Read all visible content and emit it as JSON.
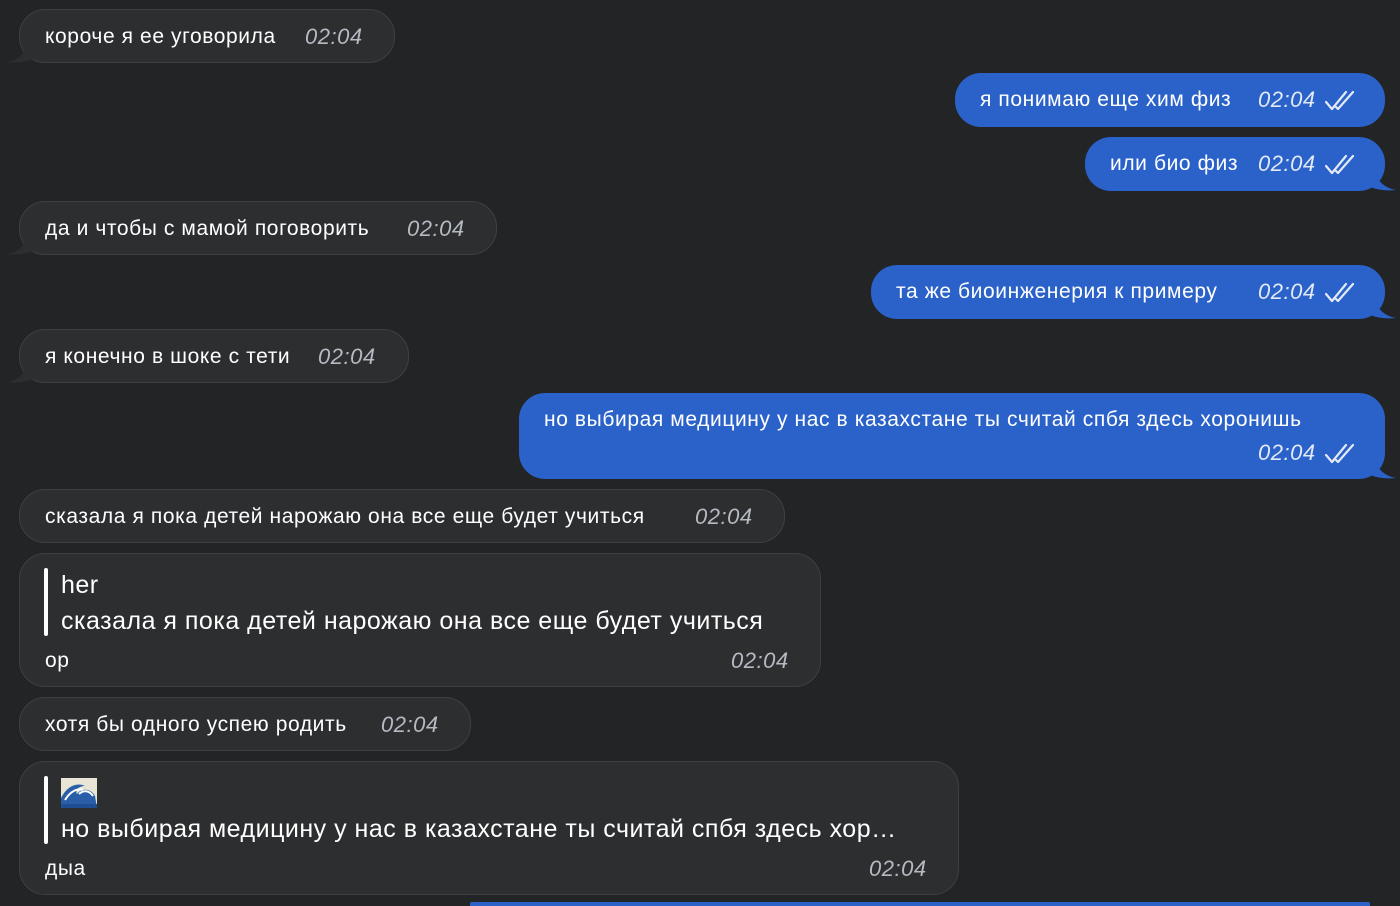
{
  "messages": [
    {
      "text": "короче я ее уговорила",
      "time": "02:04"
    },
    {
      "text": "я понимаю еще хим физ",
      "time": "02:04"
    },
    {
      "text": "или био физ",
      "time": "02:04"
    },
    {
      "text": "да и чтобы с мамой поговорить",
      "time": "02:04"
    },
    {
      "text": "та же биоинженерия к примеру",
      "time": "02:04"
    },
    {
      "text": "я конечно в шоке с тети",
      "time": "02:04"
    },
    {
      "text": "но выбирая медицину у нас в казахстане ты считай спбя здесь хоронишь",
      "time": "02:04"
    },
    {
      "text": "сказала я пока детей нарожаю она все еще будет учиться",
      "time": "02:04"
    },
    {
      "quote_author": "her",
      "quote_text": "сказала я пока детей нарожаю она все еще будет учиться",
      "text": "ор",
      "time": "02:04"
    },
    {
      "text": "хотя бы одного успею родить",
      "time": "02:04"
    },
    {
      "quote_author": "🌊",
      "quote_text": "но выбирая медицину у нас в казахстане ты считай спбя здесь хор…",
      "text": "дыа",
      "time": "02:04"
    }
  ],
  "colors": {
    "background": "#222426",
    "incoming": "#2d2e30",
    "outgoing": "#2b62c9"
  }
}
